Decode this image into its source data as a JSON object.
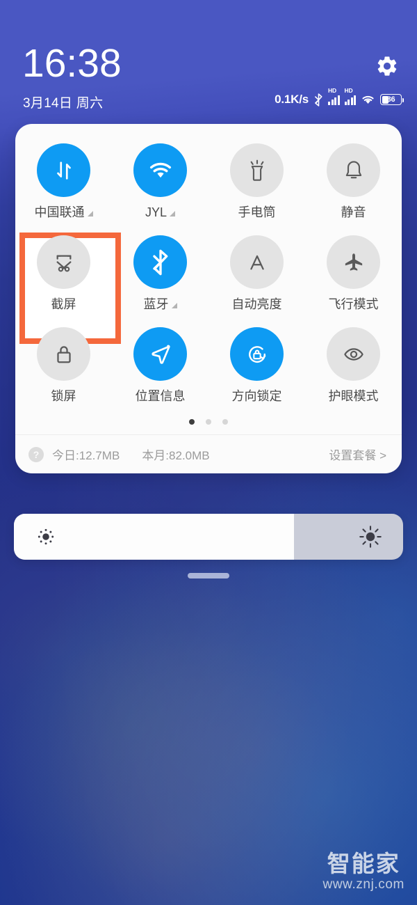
{
  "statusbar": {
    "time": "16:38",
    "date": "3月14日 周六",
    "net_speed": "0.1K/s",
    "bluetooth_icon": "bluetooth-icon",
    "sim1_label": "HD",
    "sim2_label": "HD",
    "wifi_icon": "wifi-icon",
    "battery_percent": "36",
    "settings_icon": "gear-icon"
  },
  "quick_settings": {
    "toggles": [
      {
        "label": "中国联通",
        "icon": "mobile-data-icon",
        "active": true,
        "expandable": true
      },
      {
        "label": "JYL",
        "icon": "wifi-icon",
        "active": true,
        "expandable": true
      },
      {
        "label": "手电筒",
        "icon": "flashlight-icon",
        "active": false,
        "expandable": false
      },
      {
        "label": "静音",
        "icon": "bell-mute-icon",
        "active": false,
        "expandable": false
      },
      {
        "label": "截屏",
        "icon": "screenshot-icon",
        "active": false,
        "expandable": false,
        "highlighted": true
      },
      {
        "label": "蓝牙",
        "icon": "bluetooth-icon",
        "active": true,
        "expandable": true
      },
      {
        "label": "自动亮度",
        "icon": "auto-brightness-icon",
        "active": false,
        "expandable": false
      },
      {
        "label": "飞行模式",
        "icon": "airplane-icon",
        "active": false,
        "expandable": false
      },
      {
        "label": "锁屏",
        "icon": "lock-icon",
        "active": false,
        "expandable": false
      },
      {
        "label": "位置信息",
        "icon": "location-arrow-icon",
        "active": true,
        "expandable": false
      },
      {
        "label": "方向锁定",
        "icon": "rotation-lock-icon",
        "active": true,
        "expandable": false
      },
      {
        "label": "护眼模式",
        "icon": "eye-icon",
        "active": false,
        "expandable": false
      }
    ],
    "pages": {
      "count": 3,
      "active_index": 0
    },
    "data_footer": {
      "help_icon": "help-icon",
      "today": "今日:12.7MB",
      "month": "本月:82.0MB",
      "plan_link": "设置套餐 >"
    }
  },
  "brightness": {
    "low_icon": "brightness-low-icon",
    "high_icon": "brightness-high-icon",
    "level_percent": "72"
  },
  "watermark": {
    "logo": "智能家",
    "url": "www.znj.com"
  },
  "colors": {
    "accent_on": "#0e9bf3",
    "toggle_off": "#e3e3e3",
    "highlight": "#f4683c",
    "card_bg": "#fbfbfb",
    "header_blue": "#4a57c2"
  }
}
